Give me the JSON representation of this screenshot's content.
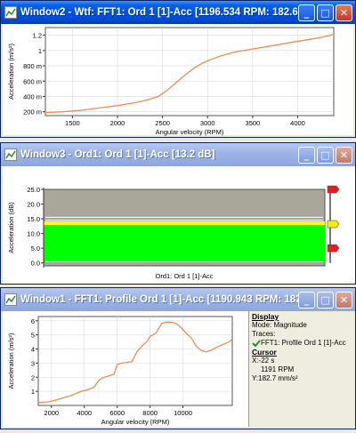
{
  "window2": {
    "title": "Window2 - Wtf: FFT1: Ord 1 [1]-Acc [1196.534 RPM: 182.66 m...",
    "chart_data": {
      "type": "line",
      "xlabel": "Angular velocity (RPM)",
      "ylabel": "Acceleration (m/s²)",
      "xlim": [
        1200,
        4400
      ],
      "ylim": [
        0.15,
        1.3
      ],
      "xticks": [
        "1500",
        "2000",
        "2500",
        "3000",
        "3500",
        "4000"
      ],
      "xtick_values": [
        1500,
        2000,
        2500,
        3000,
        3500,
        4000
      ],
      "yticks": [
        "200 m",
        "400 m",
        "600 m",
        "800 m",
        "1",
        "1.2"
      ],
      "ytick_values": [
        0.2,
        0.4,
        0.6,
        0.8,
        1.0,
        1.2
      ],
      "color": "#f08a50",
      "x": [
        1200,
        1400,
        1600,
        1800,
        2000,
        2200,
        2350,
        2450,
        2550,
        2650,
        2750,
        2850,
        2950,
        3050,
        3150,
        3300,
        3500,
        3700,
        3900,
        4100,
        4300,
        4400
      ],
      "y": [
        0.19,
        0.2,
        0.22,
        0.25,
        0.28,
        0.32,
        0.36,
        0.4,
        0.48,
        0.58,
        0.68,
        0.77,
        0.84,
        0.89,
        0.93,
        0.98,
        1.02,
        1.06,
        1.1,
        1.14,
        1.18,
        1.21
      ]
    }
  },
  "window3": {
    "title": "Window3 - Ord1: Ord 1 [1]-Acc [13.2 dB]",
    "chart_data": {
      "type": "bar",
      "xlabel": "Ord1: Ord 1 [1]-Acc",
      "ylabel": "Acceleration (dB)",
      "ylim": [
        -1,
        25
      ],
      "yticks": [
        "0.0",
        "5.0",
        "10.0",
        "15.0",
        "20.0",
        "25.0"
      ],
      "ytick_values": [
        0,
        5,
        10,
        15,
        20,
        25
      ],
      "value": 13.2,
      "range_max": 25,
      "marker_top": 25,
      "marker_bottom": 5,
      "color_bar": "#00ff00",
      "color_level": "#ffff00",
      "color_range": "#a9a799"
    }
  },
  "window1": {
    "title": "Window1 - FFT1: Profile Ord 1 [1]-Acc [1190.943 RPM: 182.7 m...",
    "chart_data": {
      "type": "line",
      "xlabel": "Angular velocity (RPM)",
      "ylabel": "Acceleration (m/s²)",
      "xlim": [
        1200,
        13000
      ],
      "ylim": [
        0,
        6.3
      ],
      "xticks": [
        "2000",
        "4000",
        "6000",
        "8000",
        "10000"
      ],
      "xtick_values": [
        2000,
        4000,
        6000,
        8000,
        10000
      ],
      "yticks": [
        "1",
        "2",
        "3",
        "4",
        "5",
        "6"
      ],
      "ytick_values": [
        1,
        2,
        3,
        4,
        5,
        6
      ],
      "color": "#f08a50",
      "x": [
        1200,
        1800,
        2200,
        2600,
        2900,
        3200,
        3500,
        3800,
        4200,
        4600,
        4900,
        5200,
        5500,
        5800,
        6000,
        6300,
        6600,
        6900,
        7200,
        7500,
        7800,
        8000,
        8200,
        8400,
        8700,
        9000,
        9300,
        9600,
        9900,
        10200,
        10500,
        10800,
        11100,
        11400,
        11700,
        12000,
        12400,
        12800,
        13000
      ],
      "y": [
        0.2,
        0.25,
        0.35,
        0.5,
        0.6,
        0.7,
        0.85,
        1.0,
        1.1,
        1.3,
        1.8,
        2.0,
        2.1,
        2.2,
        2.9,
        3.0,
        3.05,
        3.1,
        3.8,
        4.2,
        4.5,
        4.9,
        5.0,
        5.2,
        5.8,
        5.9,
        5.9,
        5.8,
        5.5,
        5.1,
        4.8,
        4.2,
        3.9,
        3.8,
        3.9,
        4.1,
        4.3,
        4.5,
        4.7
      ]
    },
    "side": {
      "display_header": "Display",
      "mode": "Mode: Magnitude",
      "traces": "Traces:",
      "trace_name": "FFT1: Profile Ord 1 [1]-Acc",
      "cursor_header": "Cursor",
      "cursor_x": "X:-22 s",
      "cursor_rpm": "1191 RPM",
      "cursor_y": "Y:182.7 mm/s²"
    }
  },
  "controls": {
    "minimize": "_",
    "maximize": "□",
    "close": "✕"
  }
}
